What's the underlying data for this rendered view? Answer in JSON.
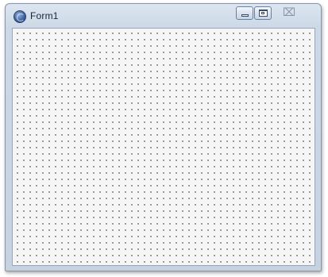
{
  "window": {
    "title": "Form1",
    "icon": "app-icon",
    "controls": {
      "minimize_icon": "minimize-icon",
      "maximize_icon": "maximize-icon",
      "close_icon": "close-icon",
      "close_glyph": "⌧"
    }
  },
  "designer": {
    "surface": "form-design-surface",
    "grid": "dotted"
  }
}
